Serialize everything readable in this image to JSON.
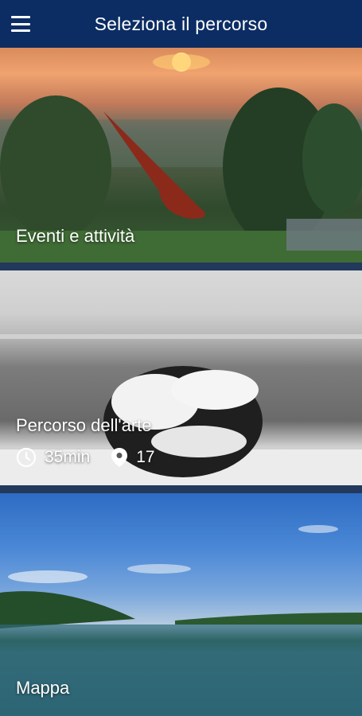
{
  "header": {
    "title": "Seleziona il percorso",
    "menu_icon": "hamburger-menu-icon"
  },
  "cards": [
    {
      "label": "Eventi e attività"
    },
    {
      "label": "Percorso dell'arte",
      "duration": "35min",
      "stops": "17",
      "duration_icon": "clock-icon",
      "stops_icon": "location-pin-icon"
    },
    {
      "label": "Mappa"
    }
  ],
  "colors": {
    "appbar": "#0c2d63",
    "text": "#ffffff"
  }
}
